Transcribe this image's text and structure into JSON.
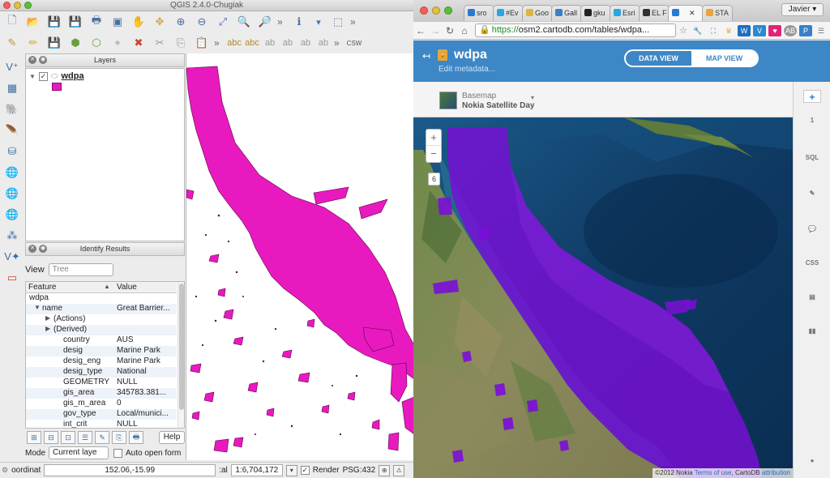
{
  "qgis": {
    "title": "QGIS 2.4.0-Chugiak",
    "layers_panel_title": "Layers",
    "layer_name": "wdpa",
    "layer_color": "#e81abf",
    "identify_panel_title": "Identify Results",
    "view_label": "View",
    "view_value": "Tree",
    "columns": {
      "feature": "Feature",
      "value": "Value"
    },
    "rows": [
      {
        "arrow": "▼",
        "feature": "wdpa",
        "value": "",
        "indent": 4
      },
      {
        "arrow": "▼",
        "feature": "name",
        "value": "Great Barrier...",
        "indent": 20
      },
      {
        "arrow": "▶",
        "feature": "(Actions)",
        "value": "",
        "indent": 34
      },
      {
        "arrow": "▶",
        "feature": "(Derived)",
        "value": "",
        "indent": 34
      },
      {
        "arrow": "",
        "feature": "country",
        "value": "AUS",
        "indent": 46
      },
      {
        "arrow": "",
        "feature": "desig",
        "value": "Marine Park",
        "indent": 46
      },
      {
        "arrow": "",
        "feature": "desig_eng",
        "value": "Marine Park",
        "indent": 46
      },
      {
        "arrow": "",
        "feature": "desig_type",
        "value": "National",
        "indent": 46
      },
      {
        "arrow": "",
        "feature": "GEOMETRY",
        "value": "NULL",
        "indent": 46
      },
      {
        "arrow": "",
        "feature": "gis_area",
        "value": "345783.381...",
        "indent": 46
      },
      {
        "arrow": "",
        "feature": "gis_m_area",
        "value": "0",
        "indent": 46
      },
      {
        "arrow": "",
        "feature": "gov_type",
        "value": "Local/munici...",
        "indent": 46
      },
      {
        "arrow": "",
        "feature": "int_crit",
        "value": "NULL",
        "indent": 46
      }
    ],
    "help_label": "Help",
    "mode_label": "Mode",
    "mode_value": "Current laye",
    "auto_open_label": "Auto open form",
    "status": {
      "coord_label": "oordinat",
      "coord_value": "152.06,-15.99",
      "scale_label": ":al",
      "scale_value": "1:6,704,172",
      "render_label": "Render",
      "epsg_label": "PSG:432"
    },
    "toolbar_icons": [
      "new-project-icon",
      "open-project-icon",
      "save-project-icon",
      "save-as-icon",
      "print-composer-icon",
      "pointer-icon",
      "pan-icon",
      "pan-to-selection-icon",
      "zoom-in-icon",
      "zoom-out-icon",
      "zoom-full-icon",
      "zoom-layer-icon",
      "identify-icon",
      "measure-icon"
    ]
  },
  "chrome": {
    "tabs": [
      {
        "label": "sro",
        "color": "#2a7ad0"
      },
      {
        "label": "#Ev",
        "color": "#29a8e0"
      },
      {
        "label": "Goo",
        "color": "#e0b43a"
      },
      {
        "label": "Gall",
        "color": "#3a7fc8"
      },
      {
        "label": "gku",
        "color": "#222222"
      },
      {
        "label": "Esri",
        "color": "#29a8e0"
      },
      {
        "label": "EL F",
        "color": "#333333"
      },
      {
        "label": "",
        "color": "#2a7ad0"
      },
      {
        "label": "STA",
        "color": "#e8a43d"
      }
    ],
    "user_label": "Javier",
    "url_scheme": "https://",
    "url_rest": "osm2.cartodb.com/tables/wdpa...",
    "extensions": [
      {
        "label": "W",
        "color": "#1c6fc0"
      },
      {
        "label": "V",
        "color": "#2a8ad0"
      },
      {
        "label": "♥",
        "color": "#e2237a"
      },
      {
        "label": "AB",
        "color": "#999999"
      },
      {
        "label": "P",
        "color": "#3a7fc8"
      }
    ]
  },
  "cartodb": {
    "table_name": "wdpa",
    "edit_metadata": "Edit metadata...",
    "data_view": "DATA VIEW",
    "map_view": "MAP VIEW",
    "basemap_label": "Basemap",
    "basemap_name": "Nokia Satellite Day",
    "zoom_in": "+",
    "zoom_out": "−",
    "zoom_level": "6",
    "attribution_prefix": "©2012 Nokia",
    "terms": "Terms of use",
    "attribution_suffix": ", CartoDB",
    "attribution_link": "attribution",
    "polygon_color": "#7a0ed8",
    "right_tools": [
      {
        "label": "+",
        "name": "add-layer-tool"
      },
      {
        "label": "1",
        "name": "layer-count-tool"
      },
      {
        "label": "SQL",
        "name": "sql-tool"
      },
      {
        "label": "✎",
        "name": "wizard-tool"
      },
      {
        "label": "💬",
        "name": "infowindow-tool"
      },
      {
        "label": "CSS",
        "name": "css-tool"
      },
      {
        "label": "▤",
        "name": "legend-tool"
      },
      {
        "label": "▮▮",
        "name": "filters-tool"
      },
      {
        "label": "●",
        "name": "help-tool"
      }
    ]
  }
}
